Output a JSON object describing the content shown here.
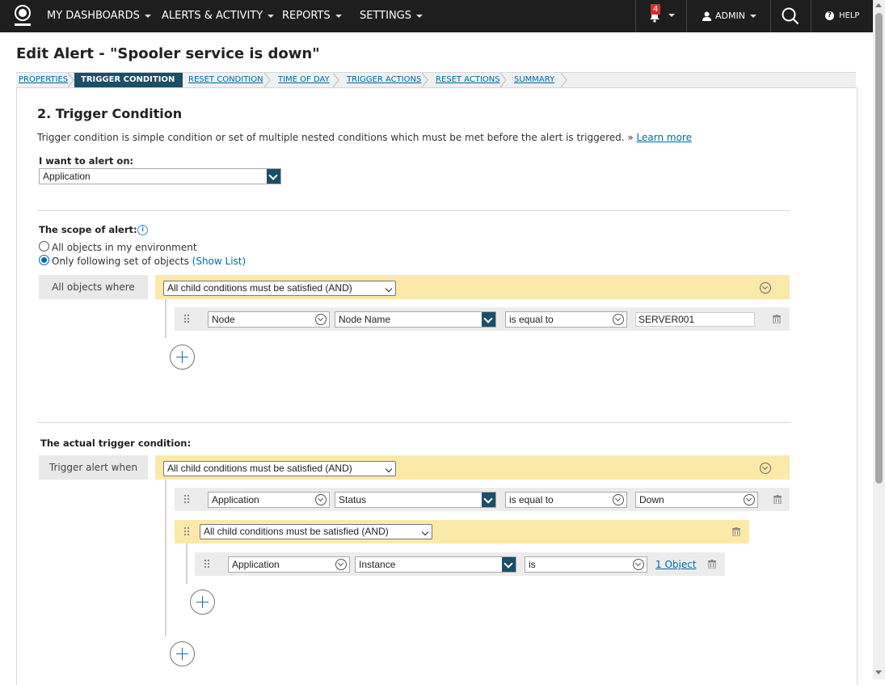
{
  "topnav": {
    "items": [
      {
        "label": "MY DASHBOARDS"
      },
      {
        "label": "ALERTS & ACTIVITY"
      },
      {
        "label": "REPORTS"
      },
      {
        "label": "SETTINGS"
      }
    ],
    "notification_count": "4",
    "user_label": "ADMIN",
    "help_label": "HELP"
  },
  "page": {
    "title": "Edit Alert - \"Spooler service is down\""
  },
  "wizard": {
    "steps": [
      {
        "label": "PROPERTIES"
      },
      {
        "label": "TRIGGER CONDITION"
      },
      {
        "label": "RESET CONDITION"
      },
      {
        "label": "TIME OF DAY"
      },
      {
        "label": "TRIGGER ACTIONS"
      },
      {
        "label": "RESET ACTIONS"
      },
      {
        "label": "SUMMARY"
      }
    ],
    "active_index": 1
  },
  "trigger": {
    "section_title": "2. Trigger Condition",
    "description": "Trigger condition is simple condition or set of multiple nested conditions which must be met before the alert is triggered. »",
    "learn_more": "Learn more",
    "alert_on_label": "I want to alert on:",
    "alert_on_value": "Application",
    "scope_label": "The scope of alert:",
    "scope_option_all": "All objects in my environment",
    "scope_option_following": "Only following set of objects",
    "show_list": "(Show List)",
    "scope_box_label": "All objects where",
    "scope_group_select": "All child conditions must be satisfied (AND)",
    "scope_condition": {
      "object": "Node",
      "field": "Node Name",
      "operator": "is equal to",
      "value": "SERVER001"
    },
    "actual_label": "The actual trigger condition:",
    "actual_box_label": "Trigger alert when",
    "actual_group_select": "All child conditions must be satisfied (AND)",
    "actual_condition": {
      "object": "Application",
      "field": "Status",
      "operator": "is equal to",
      "value": "Down"
    },
    "nested_group_select": "All child conditions must be satisfied (AND)",
    "nested_condition": {
      "object": "Application",
      "field": "Instance",
      "operator": "is",
      "value_link": "1 Object"
    }
  }
}
